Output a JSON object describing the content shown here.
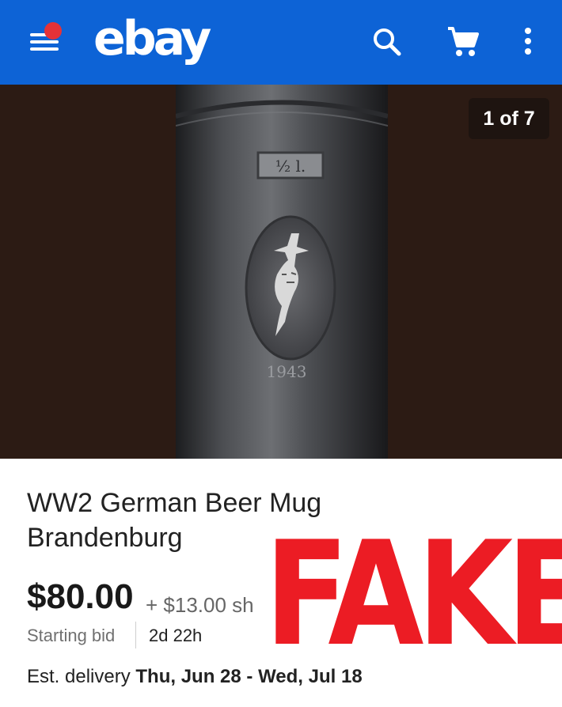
{
  "appbar": {
    "logo": "ebay",
    "icons": {
      "menu": "menu-icon",
      "search": "search-icon",
      "cart": "cart-icon",
      "more": "more-vert-icon"
    },
    "colors": {
      "background": "#0d63d6",
      "notification": "#e53238"
    }
  },
  "gallery": {
    "counter": "1 of 7",
    "photo": {
      "label_plate": "½ l.",
      "year": "1943"
    }
  },
  "listing": {
    "title": "WW2 German Beer Mug Brandenburg",
    "price": "$80.00",
    "shipping": "+ $13.00 sh",
    "starting_bid_label": "Starting bid",
    "time_left": "2d 22h",
    "delivery_label": "Est. delivery",
    "delivery_dates": "Thu, Jun 28 - Wed, Jul 18"
  },
  "overlay": {
    "text": "FAKE",
    "color": "#ec1c24"
  }
}
